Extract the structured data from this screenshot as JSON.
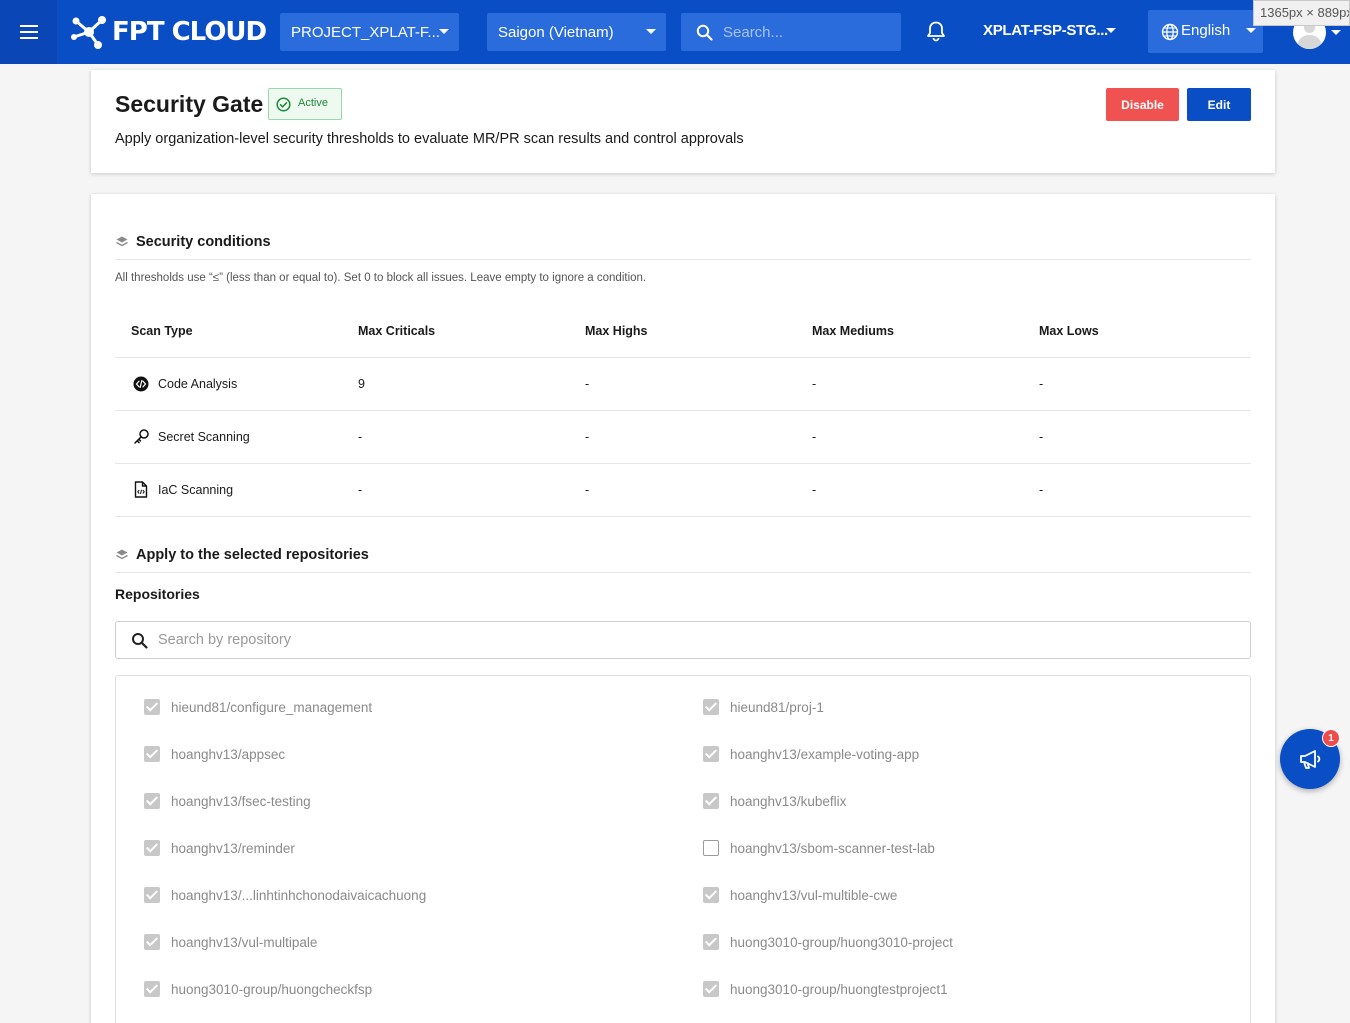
{
  "topbar": {
    "brand": "FPT CLOUD",
    "project": "PROJECT_XPLAT-F...",
    "region": "Saigon (Vietnam)",
    "search_placeholder": "Search...",
    "account": "XPLAT-FSP-STG...",
    "language": "English",
    "viewport_readout": "1365px × 889px",
    "accent_color": "#0a4ec6"
  },
  "header": {
    "title": "Security Gate",
    "status": "Active",
    "description": "Apply organization-level security thresholds to evaluate MR/PR scan results and control approvals",
    "disable_label": "Disable",
    "edit_label": "Edit"
  },
  "conditions": {
    "heading": "Security conditions",
    "note": "All thresholds use “≤” (less than or equal to). Set 0 to block all issues. Leave empty to ignore a condition.",
    "columns": [
      "Scan Type",
      "Max Criticals",
      "Max Highs",
      "Max Mediums",
      "Max Lows"
    ],
    "rows": [
      {
        "icon": "code-analysis-icon",
        "name": "Code Analysis",
        "critical": "9",
        "high": "-",
        "medium": "-",
        "low": "-"
      },
      {
        "icon": "key-icon",
        "name": "Secret Scanning",
        "critical": "-",
        "high": "-",
        "medium": "-",
        "low": "-"
      },
      {
        "icon": "file-code-icon",
        "name": "IaC Scanning",
        "critical": "-",
        "high": "-",
        "medium": "-",
        "low": "-"
      }
    ]
  },
  "repositories": {
    "heading": "Apply to the selected repositories",
    "label": "Repositories",
    "search_placeholder": "Search by repository",
    "items": [
      {
        "name": "hieund81/configure_management",
        "checked": true
      },
      {
        "name": "hieund81/proj-1",
        "checked": true
      },
      {
        "name": "hoanghv13/appsec",
        "checked": true
      },
      {
        "name": "hoanghv13/example-voting-app",
        "checked": true
      },
      {
        "name": "hoanghv13/fsec-testing",
        "checked": true
      },
      {
        "name": "hoanghv13/kubeflix",
        "checked": true
      },
      {
        "name": "hoanghv13/reminder",
        "checked": true
      },
      {
        "name": "hoanghv13/sbom-scanner-test-lab",
        "checked": false
      },
      {
        "name": "hoanghv13/...linhtinhchonodaivaicachuong",
        "checked": true
      },
      {
        "name": "hoanghv13/vul-multible-cwe",
        "checked": true
      },
      {
        "name": "hoanghv13/vul-multipale",
        "checked": true
      },
      {
        "name": "huong3010-group/huong3010-project",
        "checked": true
      },
      {
        "name": "huong3010-group/huongcheckfsp",
        "checked": true
      },
      {
        "name": "huong3010-group/huongtestproject1",
        "checked": true
      }
    ]
  },
  "fab": {
    "icon": "megaphone-icon",
    "badge": "1"
  }
}
